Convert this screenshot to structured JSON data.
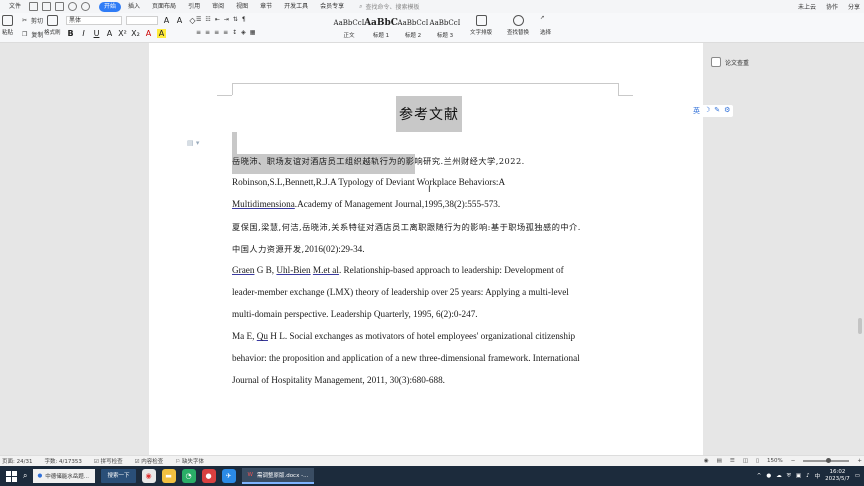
{
  "menubar": {
    "file": "文件",
    "items": [
      "开始",
      "插入",
      "页面布局",
      "引用",
      "审阅",
      "视图",
      "章节",
      "开发工具",
      "会员专享"
    ],
    "active_index": 0,
    "search_placeholder": "查找命令、搜索模板",
    "right": [
      "未上云",
      "协作",
      "分享"
    ]
  },
  "ribbon": {
    "paste": "粘贴",
    "cut": "剪切",
    "copy": "复制",
    "format_painter": "格式刷",
    "font_name": "黑体",
    "format_buttons": [
      "B",
      "I",
      "U",
      "A",
      "X²",
      "X₂",
      "A",
      "A"
    ],
    "styles": [
      {
        "sample": "AaBbCcI",
        "label": "正文"
      },
      {
        "sample": "AaBbC",
        "label": "标题 1"
      },
      {
        "sample": "AaBbCcI",
        "label": "标题 2"
      },
      {
        "sample": "AaBbCcI",
        "label": "标题 3"
      }
    ],
    "text_layout": "文字排版",
    "find_replace": "查找替换",
    "select": "选择"
  },
  "document": {
    "title": "参考文献",
    "references": [
      [
        {
          "t": "岳晓沛、职场友谊对酒店员工组织越轨行为的影响研究.兰州财经大学,2022.",
          "cn": true
        }
      ],
      [
        {
          "t": "Robinson,S.L,Bennett,R.J.A Typology of Deviant Workplace Behaviors:A"
        }
      ],
      [
        {
          "t": "Multidimensiona",
          "u": true
        },
        {
          "t": ".Academy of Management Journal,1995,38(2):555-573."
        }
      ],
      [
        {
          "t": "夏保国,梁慧,何洁,岳晓沛,关系特征对酒店员工离职跟随行为的影响:基于职场孤独感的中介.",
          "cn": true
        }
      ],
      [
        {
          "t": "中国人力资源开发,",
          "cn": true
        },
        {
          "t": "2016(02):29-34."
        }
      ],
      [
        {
          "t": "Graen",
          "u": true
        },
        {
          "t": " G B, "
        },
        {
          "t": "Uhl-Bien",
          "u": true
        },
        {
          "t": " "
        },
        {
          "t": "M.et al",
          "u": true
        },
        {
          "t": ". Relationship-based approach to leadership: Development of"
        }
      ],
      [
        {
          "t": "leader-member exchange (LMX) theory of leadership over 25 years: Applying a multi-level"
        }
      ],
      [
        {
          "t": "multi-domain perspective. Leadership Quarterly, 1995, 6(2):0-247."
        }
      ],
      [
        {
          "t": "Ma E, "
        },
        {
          "t": "Qu",
          "u": true
        },
        {
          "t": " H L. Social exchanges as motivators of hotel employees' organizational citizenship"
        }
      ],
      [
        {
          "t": "behavior: the proposition and application of a new three-dimensional framework. International"
        }
      ],
      [
        {
          "t": "Journal of Hospitality Management, 2011, 30(3):680-688."
        }
      ]
    ]
  },
  "side_panel": {
    "paper_check": "论文查重",
    "float_tools": [
      "英",
      "☽",
      "✎",
      "⚙"
    ]
  },
  "statusbar": {
    "page": "页面: 24/31",
    "words": "字数: 4/17353",
    "spell": "拼写检查",
    "content_check": "内容检查",
    "missing_font": "缺失字体",
    "zoom": "150%"
  },
  "taskbar": {
    "search_text": "中德储能水岳题...",
    "search_button": "搜索一下",
    "task_label": "需调整原版.docx -...",
    "time": "16:02",
    "date": "2023/5/7",
    "lang": "中"
  }
}
